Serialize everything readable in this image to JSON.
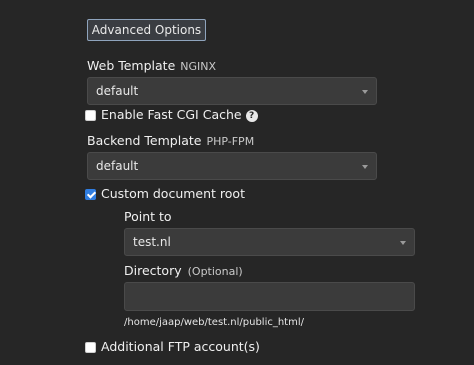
{
  "advanced_button": "Advanced Options",
  "web_template": {
    "label": "Web Template",
    "sub": "NGINX",
    "value": "default"
  },
  "fast_cgi": {
    "label": "Enable Fast CGI Cache",
    "checked": false
  },
  "backend_template": {
    "label": "Backend Template",
    "sub": "PHP-FPM",
    "value": "default"
  },
  "custom_docroot": {
    "label": "Custom document root",
    "checked": true
  },
  "point_to": {
    "label": "Point to",
    "value": "test.nl"
  },
  "directory": {
    "label": "Directory",
    "optional": "(Optional)",
    "value": "",
    "path_hint": "/home/jaap/web/test.nl/public_html/"
  },
  "additional_ftp": {
    "label": "Additional FTP account(s)",
    "checked": false
  },
  "colors": {
    "accent": "#2f7de1",
    "background": "#262626",
    "field": "#3b3b3b"
  }
}
